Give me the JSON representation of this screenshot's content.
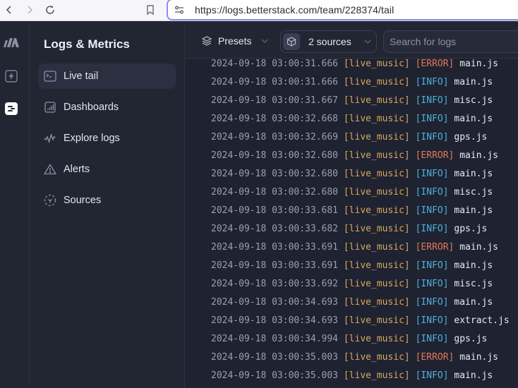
{
  "browser": {
    "url": "https://logs.betterstack.com/team/228374/tail",
    "icons": [
      "back-arrow-icon",
      "forward-arrow-icon",
      "reload-icon",
      "bookmark-icon",
      "site-settings-icon"
    ]
  },
  "rail": {
    "icons": [
      "betterstack-logo-icon",
      "uptime-bolt-icon",
      "logs-app-icon"
    ]
  },
  "sidebar": {
    "title": "Logs & Metrics",
    "items": [
      {
        "label": "Live tail",
        "icon": "terminal-icon",
        "active": true
      },
      {
        "label": "Dashboards",
        "icon": "bar-chart-icon",
        "active": false
      },
      {
        "label": "Explore logs",
        "icon": "pulse-icon",
        "active": false
      },
      {
        "label": "Alerts",
        "icon": "warning-triangle-icon",
        "active": false
      },
      {
        "label": "Sources",
        "icon": "sources-icon",
        "active": false
      }
    ]
  },
  "toolbar": {
    "presets_label": "Presets",
    "sources_label": "2 sources",
    "search_placeholder": "Search for logs",
    "search_value": ""
  },
  "colors": {
    "source": "#d7a85c",
    "info": "#4fb1dd",
    "error": "#e07a5a",
    "url_focus": "#8f8cf0"
  },
  "logs": [
    {
      "timestamp": "2024-09-18 03:00:31.666",
      "source": "[live_music]",
      "level": "[ERROR]",
      "file": "main.js"
    },
    {
      "timestamp": "2024-09-18 03:00:31.666",
      "source": "[live_music]",
      "level": "[INFO]",
      "file": "main.js"
    },
    {
      "timestamp": "2024-09-18 03:00:31.667",
      "source": "[live_music]",
      "level": "[INFO]",
      "file": "misc.js"
    },
    {
      "timestamp": "2024-09-18 03:00:32.668",
      "source": "[live_music]",
      "level": "[INFO]",
      "file": "main.js"
    },
    {
      "timestamp": "2024-09-18 03:00:32.669",
      "source": "[live_music]",
      "level": "[INFO]",
      "file": "gps.js"
    },
    {
      "timestamp": "2024-09-18 03:00:32.680",
      "source": "[live_music]",
      "level": "[ERROR]",
      "file": "main.js"
    },
    {
      "timestamp": "2024-09-18 03:00:32.680",
      "source": "[live_music]",
      "level": "[INFO]",
      "file": "main.js"
    },
    {
      "timestamp": "2024-09-18 03:00:32.680",
      "source": "[live_music]",
      "level": "[INFO]",
      "file": "misc.js"
    },
    {
      "timestamp": "2024-09-18 03:00:33.681",
      "source": "[live_music]",
      "level": "[INFO]",
      "file": "main.js"
    },
    {
      "timestamp": "2024-09-18 03:00:33.682",
      "source": "[live_music]",
      "level": "[INFO]",
      "file": "gps.js"
    },
    {
      "timestamp": "2024-09-18 03:00:33.691",
      "source": "[live_music]",
      "level": "[ERROR]",
      "file": "main.js"
    },
    {
      "timestamp": "2024-09-18 03:00:33.691",
      "source": "[live_music]",
      "level": "[INFO]",
      "file": "main.js"
    },
    {
      "timestamp": "2024-09-18 03:00:33.692",
      "source": "[live_music]",
      "level": "[INFO]",
      "file": "misc.js"
    },
    {
      "timestamp": "2024-09-18 03:00:34.693",
      "source": "[live_music]",
      "level": "[INFO]",
      "file": "main.js"
    },
    {
      "timestamp": "2024-09-18 03:00:34.693",
      "source": "[live_music]",
      "level": "[INFO]",
      "file": "extract.js"
    },
    {
      "timestamp": "2024-09-18 03:00:34.994",
      "source": "[live_music]",
      "level": "[INFO]",
      "file": "gps.js"
    },
    {
      "timestamp": "2024-09-18 03:00:35.003",
      "source": "[live_music]",
      "level": "[ERROR]",
      "file": "main.js"
    },
    {
      "timestamp": "2024-09-18 03:00:35.003",
      "source": "[live_music]",
      "level": "[INFO]",
      "file": "main.js"
    }
  ]
}
